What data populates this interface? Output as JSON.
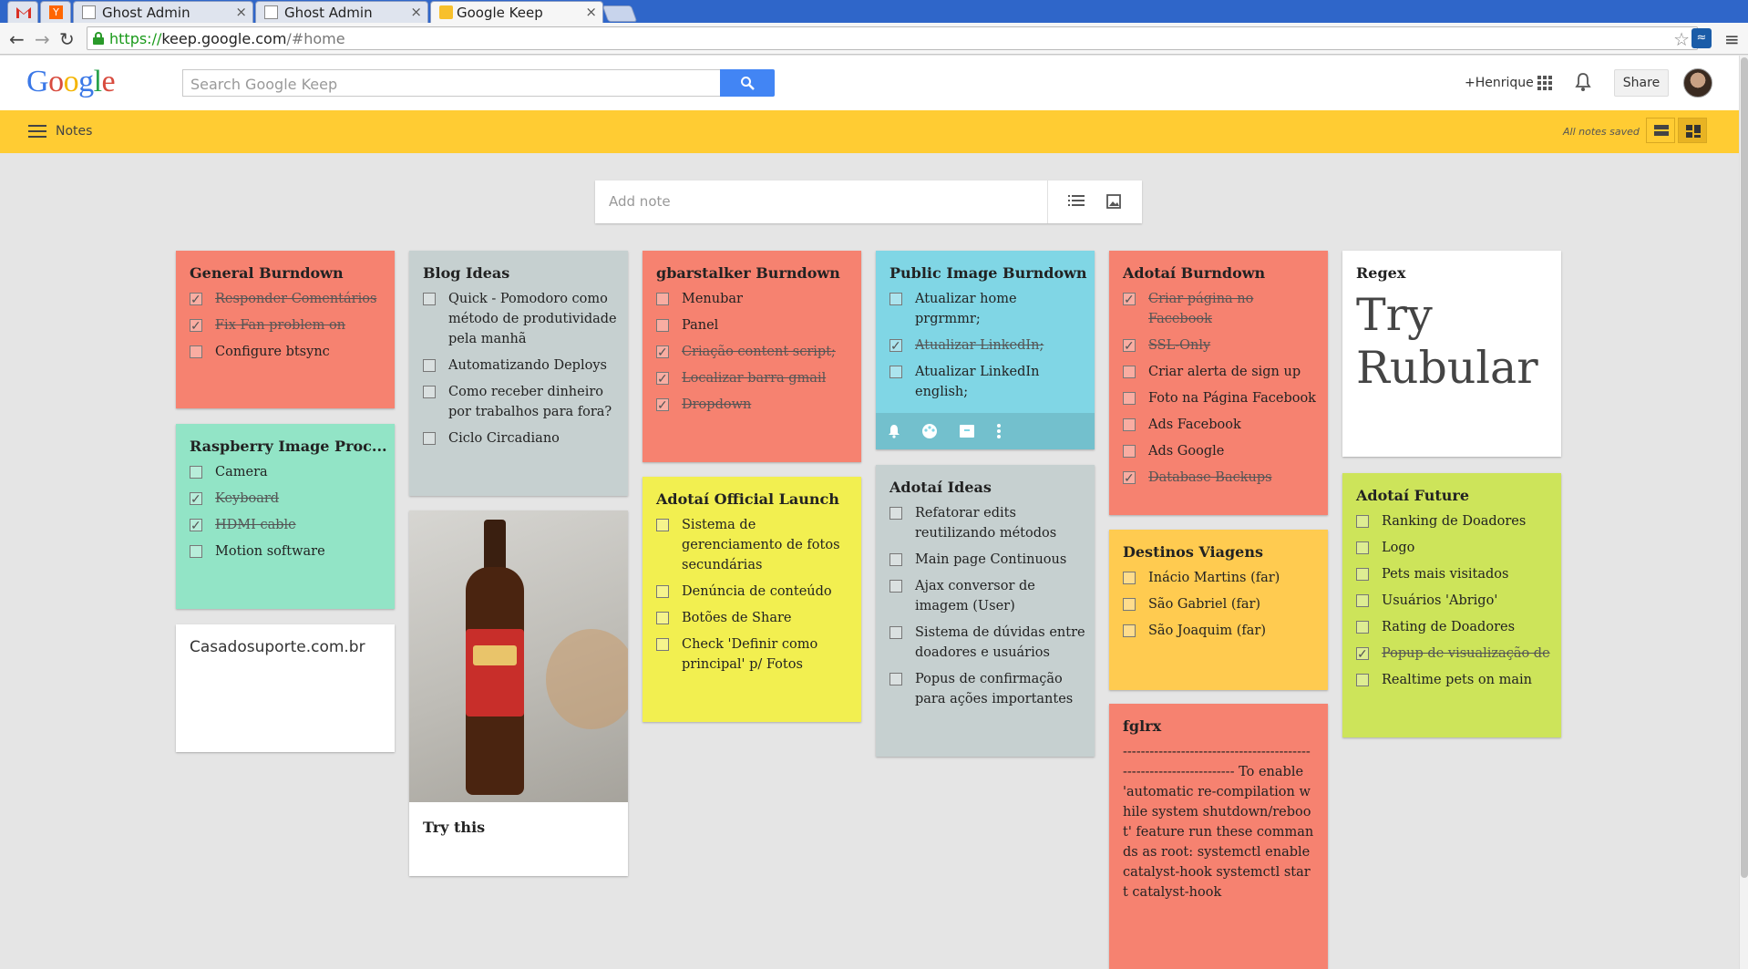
{
  "browser": {
    "tabs": [
      {
        "title": "Ghost Admin",
        "close": "×"
      },
      {
        "title": "Ghost Admin",
        "close": "×"
      },
      {
        "title": "Google Keep",
        "close": "×"
      }
    ],
    "url_scheme": "https://",
    "url_host": "keep.google.com",
    "url_path": "/#home"
  },
  "header": {
    "logo": [
      "G",
      "o",
      "o",
      "g",
      "l",
      "e"
    ],
    "search_placeholder": "Search Google Keep",
    "plus_user": "+Henrique",
    "share_label": "Share"
  },
  "appbar": {
    "section": "Notes",
    "status": "All notes saved"
  },
  "add_note": {
    "placeholder": "Add note"
  },
  "notes": {
    "general_burndown": {
      "title": "General Burndown",
      "items": [
        {
          "text": "Responder Comentários",
          "done": true
        },
        {
          "text": "Fix Fan problem on",
          "done": true
        },
        {
          "text": "Configure btsync",
          "done": false
        }
      ]
    },
    "raspberry": {
      "title": "Raspberry Image Proc...",
      "items": [
        {
          "text": "Camera",
          "done": false
        },
        {
          "text": "Keyboard",
          "done": true
        },
        {
          "text": "HDMI cable",
          "done": true
        },
        {
          "text": "Motion software",
          "done": false
        }
      ]
    },
    "casadosuporte": {
      "text": "Casadosuporte.com.br"
    },
    "blog_ideas": {
      "title": "Blog Ideas",
      "items": [
        {
          "text": "Quick - Pomodoro como método de produtividade pela manhã",
          "done": false
        },
        {
          "text": "Automatizando Deploys",
          "done": false
        },
        {
          "text": "Como receber dinheiro por trabalhos para fora?",
          "done": false
        },
        {
          "text": "Ciclo Circadiano",
          "done": false
        }
      ]
    },
    "try_this": {
      "title": "Try this"
    },
    "gbarstalker": {
      "title": "gbarstalker Burndown",
      "items": [
        {
          "text": "Menubar",
          "done": false
        },
        {
          "text": "Panel",
          "done": false
        },
        {
          "text": "Criação content script;",
          "done": true
        },
        {
          "text": "Localizar barra gmail",
          "done": true
        },
        {
          "text": "Dropdown",
          "done": true
        }
      ]
    },
    "official_launch": {
      "title": "Adotaí Official Launch",
      "items": [
        {
          "text": "Sistema de gerenciamento de fotos secundárias",
          "done": false
        },
        {
          "text": "Denúncia de conteúdo",
          "done": false
        },
        {
          "text": "Botões de Share",
          "done": false
        },
        {
          "text": "Check 'Definir como principal' p/ Fotos",
          "done": false
        }
      ]
    },
    "public_image": {
      "title": "Public Image Burndown",
      "items": [
        {
          "text": "Atualizar home prgrmmr;",
          "done": false
        },
        {
          "text": "Atualizar LinkedIn;",
          "done": true
        },
        {
          "text": "Atualizar LinkedIn english;",
          "done": false
        }
      ]
    },
    "adotai_ideas": {
      "title": "Adotaí Ideas",
      "items": [
        {
          "text": "Refatorar edits reutilizando métodos",
          "done": false
        },
        {
          "text": "Main page Continuous",
          "done": false
        },
        {
          "text": "Ajax conversor de imagem (User)",
          "done": false
        },
        {
          "text": "Sistema de dúvidas entre doadores e usuários",
          "done": false
        },
        {
          "text": "Popus de confirmação para ações importantes",
          "done": false
        }
      ]
    },
    "adotai_burndown": {
      "title": "Adotaí Burndown",
      "items": [
        {
          "text": "Criar página no Facebook",
          "done": true
        },
        {
          "text": "SSL-Only",
          "done": true
        },
        {
          "text": "Criar alerta de sign up",
          "done": false
        },
        {
          "text": "Foto na Página Facebook",
          "done": false
        },
        {
          "text": "Ads Facebook",
          "done": false
        },
        {
          "text": "Ads Google",
          "done": false
        },
        {
          "text": "Database Backups",
          "done": true
        }
      ]
    },
    "destinos": {
      "title": "Destinos Viagens",
      "items": [
        {
          "text": "Inácio Martins (far)",
          "done": false
        },
        {
          "text": "São Gabriel (far)",
          "done": false
        },
        {
          "text": "São Joaquim (far)",
          "done": false
        }
      ]
    },
    "fglrx": {
      "title": "fglrx",
      "body": "------------------------------------------------------------------- To enable 'automatic re-compilation while system shutdown/reboot' feature run these commands as root: systemctl enable catalyst-hook systemctl start catalyst-hook"
    },
    "regex": {
      "title": "Regex",
      "big": "Try Rubular"
    },
    "adotai_future": {
      "title": "Adotaí Future",
      "items": [
        {
          "text": "Ranking de Doadores",
          "done": false
        },
        {
          "text": "Logo",
          "done": false
        },
        {
          "text": "Pets mais visitados",
          "done": false
        },
        {
          "text": "Usuários 'Abrigo'",
          "done": false
        },
        {
          "text": "Rating de Doadores",
          "done": false
        },
        {
          "text": "Popup de visualização de",
          "done": true
        },
        {
          "text": "Realtime pets on main",
          "done": false
        }
      ]
    }
  }
}
